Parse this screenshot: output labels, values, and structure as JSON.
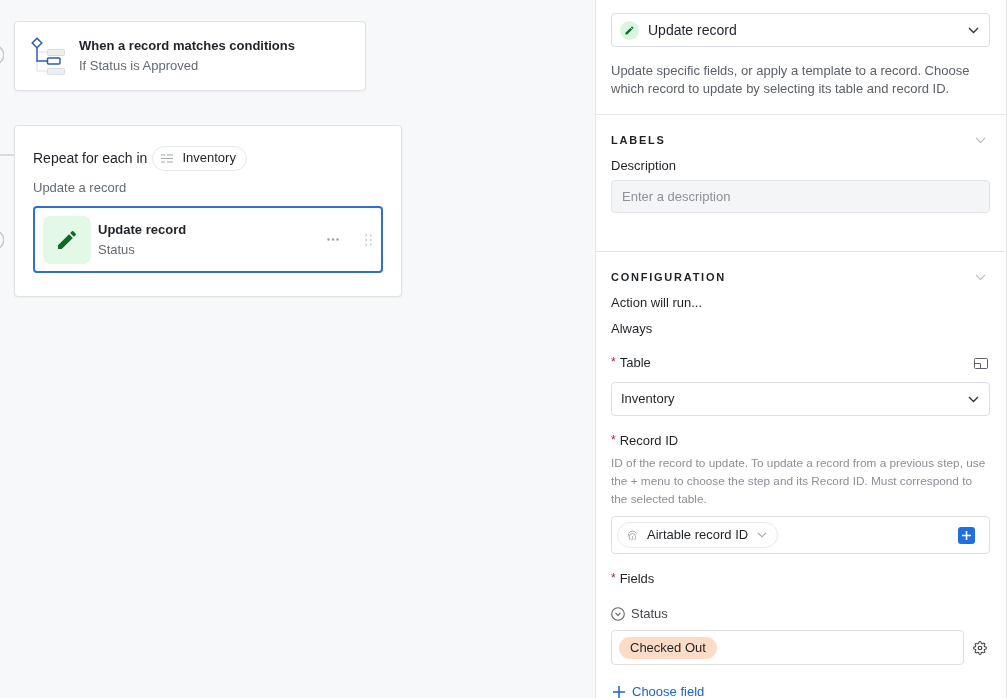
{
  "canvas": {
    "trigger": {
      "title": "When a record matches conditions",
      "condition": "If Status is Approved"
    },
    "repeat": {
      "label": "Repeat for each in",
      "table": "Inventory",
      "group_label": "Update a record",
      "actions": [
        {
          "title": "Update record",
          "subtitle": "Status",
          "selected": true
        }
      ]
    }
  },
  "panel": {
    "action_type": {
      "value": "Update record"
    },
    "action_description": "Update specific fields, or apply a template to a record. Choose which record to update by selecting its table and record ID.",
    "sections": [
      {
        "heading": "LABELS",
        "fields": [
          {
            "kind": "text_input",
            "label": "Description",
            "placeholder": "Enter a description"
          }
        ]
      },
      {
        "heading": "CONFIGURATION",
        "fields": [
          {
            "kind": "static",
            "label": "Action will run...",
            "value": "Always"
          },
          {
            "kind": "select",
            "label": "Table",
            "required_mark": "*",
            "value": "Inventory"
          },
          {
            "kind": "record_picker",
            "label": "Record ID",
            "required_mark": "*",
            "help": "ID of the record to update. To update a record from a previous step, use the + menu to choose the step and its Record ID. Must correspond to the selected table.",
            "chip": "Airtable record ID"
          },
          {
            "kind": "field_list",
            "label": "Fields",
            "required_mark": "*",
            "items": [
              {
                "name": "Status",
                "value": "Checked Out",
                "color": "#fcdcc6"
              }
            ],
            "add_link": "Choose field"
          }
        ]
      }
    ]
  }
}
